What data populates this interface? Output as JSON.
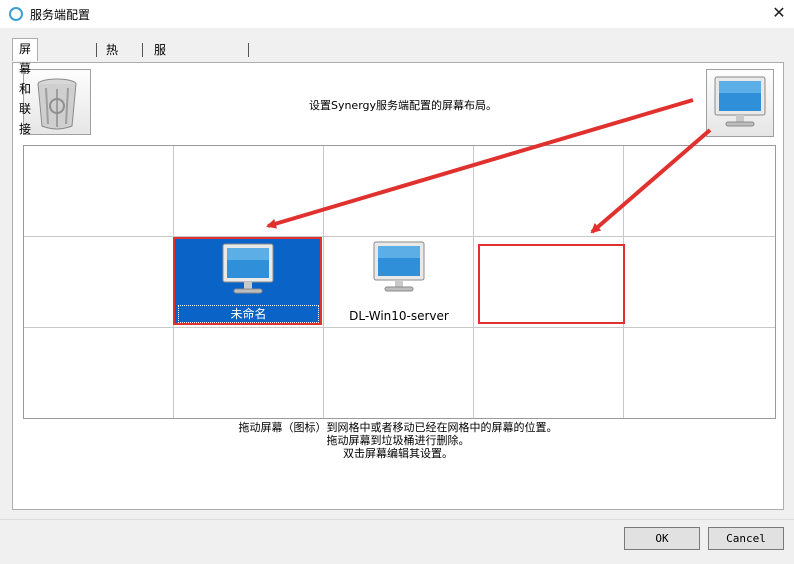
{
  "window": {
    "title": "服务端配置",
    "close_glyph": "✕"
  },
  "tabs": [
    {
      "label": "屏幕和联接",
      "selected": true
    },
    {
      "label": "热键",
      "selected": false
    },
    {
      "label": "服务端高级设置",
      "selected": false
    }
  ],
  "panel": {
    "hint": "设置Synergy服务端配置的屏幕布局。",
    "trash_icon": "trash-bin-icon",
    "new_screen_icon": "monitor-icon"
  },
  "grid": {
    "columns": 5,
    "rows": 3,
    "screens": [
      {
        "name": "未命名",
        "selected": true
      },
      {
        "name": "DL-Win10-server",
        "selected": false
      }
    ]
  },
  "instructions": {
    "line1": "拖动屏幕（图标）到网格中或者移动已经在网格中的屏幕的位置。",
    "line2": "拖动屏幕到垃圾桶进行删除。",
    "line3": "双击屏幕编辑其设置。"
  },
  "buttons": {
    "ok": "OK",
    "cancel": "Cancel"
  },
  "colors": {
    "selection": "#0a64c8",
    "annotation": "#e0312f"
  }
}
